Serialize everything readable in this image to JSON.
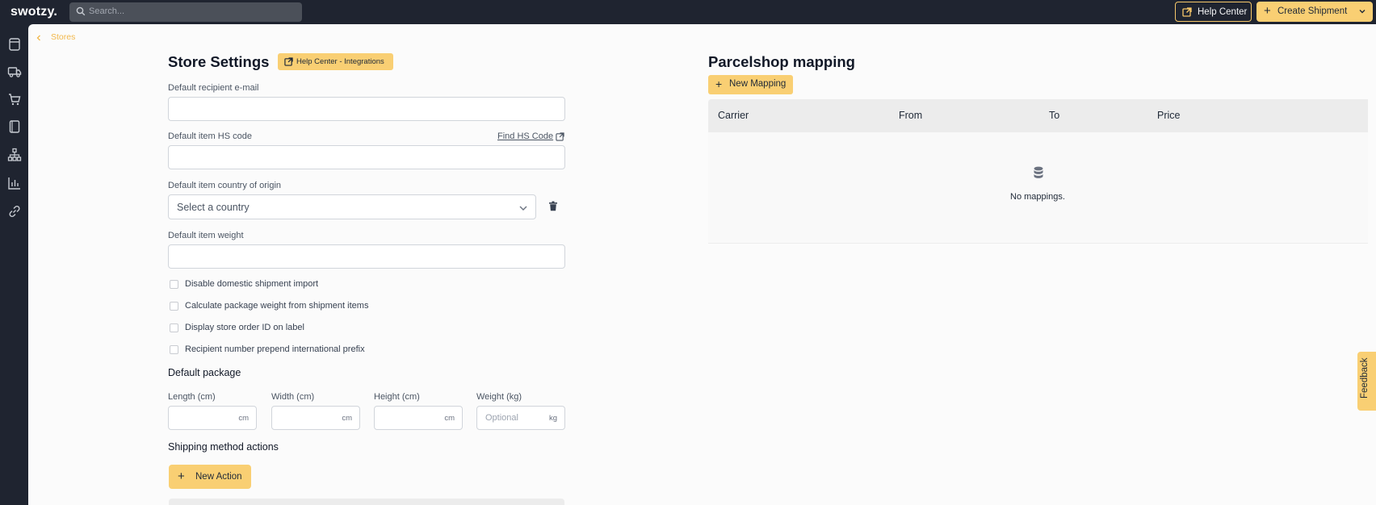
{
  "topbar": {
    "logo": "swotzy.",
    "search_placeholder": "Search...",
    "help_center_label": "Help Center",
    "create_shipment_label": "Create Shipment"
  },
  "sidebar": {
    "icons": [
      "orders-icon",
      "truck-icon",
      "cart-icon",
      "book-icon",
      "hierarchy-icon",
      "chart-icon",
      "link-icon"
    ]
  },
  "breadcrumb": {
    "label": "Stores"
  },
  "store_settings": {
    "title": "Store Settings",
    "help_badge": "Help Center - Integrations",
    "recipient_email_label": "Default recipient e-mail",
    "recipient_email_value": "",
    "hs_code_label": "Default item HS code",
    "hs_code_link": "Find HS Code",
    "hs_code_value": "",
    "country_label": "Default item country of origin",
    "country_select_value": "Select a country",
    "weight_label": "Default item weight",
    "weight_value": "",
    "checkboxes": [
      "Disable domestic shipment import",
      "Calculate package weight from shipment items",
      "Display store order ID on label",
      "Recipient number prepend international prefix"
    ],
    "default_package_title": "Default package",
    "dims": [
      {
        "label": "Length (cm)",
        "unit": "cm",
        "placeholder": ""
      },
      {
        "label": "Width (cm)",
        "unit": "cm",
        "placeholder": ""
      },
      {
        "label": "Height (cm)",
        "unit": "cm",
        "placeholder": ""
      },
      {
        "label": "Weight (kg)",
        "unit": "kg",
        "placeholder": "Optional"
      }
    ],
    "shipping_actions_title": "Shipping method actions",
    "new_action_label": "New Action"
  },
  "parcelshop": {
    "title": "Parcelshop mapping",
    "new_mapping_label": "New Mapping",
    "columns": [
      "Carrier",
      "From",
      "To",
      "Price"
    ],
    "empty_text": "No mappings."
  },
  "feedback_label": "Feedback",
  "colors": {
    "accent": "#f9cf73",
    "dark": "#1f2430",
    "link_accent": "#f2b84b"
  }
}
